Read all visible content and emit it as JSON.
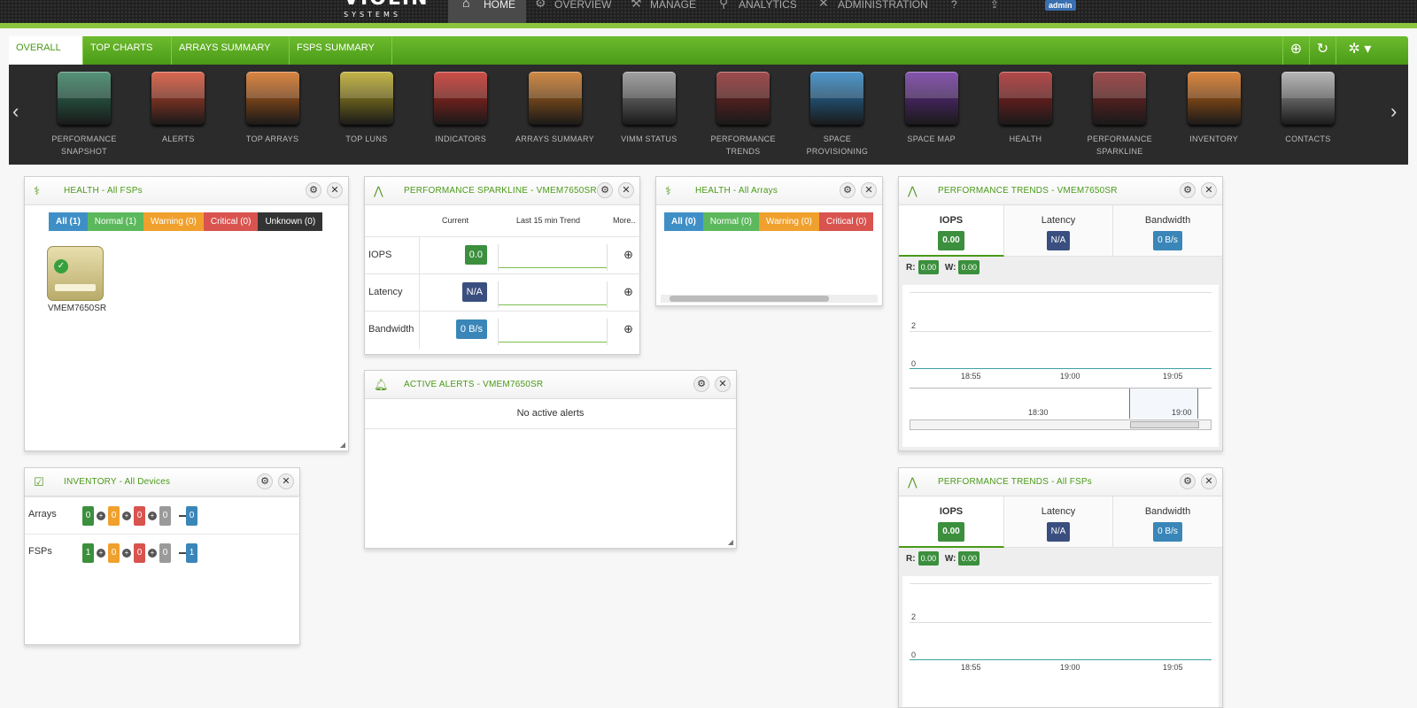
{
  "app": {
    "logo_main": "VIOLIN",
    "logo_sub": "SYSTEMS",
    "user_badge": "admin"
  },
  "nav": [
    {
      "label": "HOME",
      "icon": "home-icon"
    },
    {
      "label": "OVERVIEW",
      "icon": "gear-icon"
    },
    {
      "label": "MANAGE",
      "icon": "wrench-icon"
    },
    {
      "label": "ANALYTICS",
      "icon": "search-icon"
    },
    {
      "label": "ADMINISTRATION",
      "icon": "tools-icon"
    }
  ],
  "tabs": [
    "OVERALL",
    "TOP CHARTS",
    "ARRAYS SUMMARY",
    "FSPS SUMMARY"
  ],
  "carousel": [
    {
      "label": "PERFORMANCE SNAPSHOT",
      "line1": "PERFORMANCE",
      "line2": "SNAPSHOT",
      "icon": "gauge-icon",
      "color": "#2e7b5c"
    },
    {
      "label": "ALERTS",
      "line1": "ALERTS",
      "line2": "",
      "icon": "alarm-icon",
      "color": "#d4472a"
    },
    {
      "label": "TOP ARRAYS",
      "line1": "TOP ARRAYS",
      "line2": "",
      "icon": "arrays-growth-icon",
      "color": "#d36a17"
    },
    {
      "label": "TOP LUNS",
      "line1": "TOP LUNS",
      "line2": "",
      "icon": "database-growth-icon",
      "color": "#b7a51e"
    },
    {
      "label": "INDICATORS",
      "line1": "INDICATORS",
      "line2": "",
      "icon": "thermometer-icon",
      "color": "#c4261f"
    },
    {
      "label": "ARRAYS SUMMARY",
      "line1": "ARRAYS SUMMARY",
      "line2": "",
      "icon": "info-icon",
      "color": "#c46f19"
    },
    {
      "label": "VIMM STATUS",
      "line1": "VIMM STATUS",
      "line2": "",
      "icon": "server-rack-icon",
      "color": "#8d8d8d"
    },
    {
      "label": "PERFORMANCE TRENDS",
      "line1": "PERFORMANCE",
      "line2": "TRENDS",
      "icon": "trend-chart-icon",
      "color": "#8a2424"
    },
    {
      "label": "SPACE PROVISIONING",
      "line1": "SPACE",
      "line2": "PROVISIONING",
      "icon": "disk-stack-icon",
      "color": "#2680c0"
    },
    {
      "label": "SPACE MAP",
      "line1": "SPACE MAP",
      "line2": "",
      "icon": "pie-chart-icon",
      "color": "#6b2e9c"
    },
    {
      "label": "HEALTH",
      "line1": "HEALTH",
      "line2": "",
      "icon": "heartbeat-icon",
      "color": "#a52020"
    },
    {
      "label": "PERFORMANCE SPARKLINE",
      "line1": "PERFORMANCE",
      "line2": "SPARKLINE",
      "icon": "sparkline-icon",
      "color": "#8a2424"
    },
    {
      "label": "INVENTORY",
      "line1": "INVENTORY",
      "line2": "",
      "icon": "bar-chart-icon",
      "color": "#d46b12"
    },
    {
      "label": "CONTACTS",
      "line1": "CONTACTS",
      "line2": "",
      "icon": "phone-icon",
      "color": "#a8a8a8"
    }
  ],
  "health_fsps": {
    "title": "HEALTH - All FSPs",
    "filters": [
      {
        "label": "All (1)",
        "color": "#3f8fc7"
      },
      {
        "label": "Normal (1)",
        "color": "#5cb85c"
      },
      {
        "label": "Warning (0)",
        "color": "#f0a02c"
      },
      {
        "label": "Critical (0)",
        "color": "#d9534f"
      },
      {
        "label": "Unknown (0)",
        "color": "#333333"
      }
    ],
    "device": "VMEM7650SR"
  },
  "sparkline": {
    "title": "PERFORMANCE SPARKLINE - VMEM7650SR",
    "col_current": "Current",
    "col_trend": "Last 15 min Trend",
    "col_more": "More..",
    "rows": [
      {
        "label": "IOPS",
        "value": "0.0",
        "color": "#3b8f3d"
      },
      {
        "label": "Latency",
        "value": "N/A",
        "color": "#3a4f80"
      },
      {
        "label": "Bandwidth",
        "value": "0 B/s",
        "color": "#3a86b8"
      }
    ]
  },
  "health_arrays": {
    "title": "HEALTH - All Arrays",
    "filters": [
      {
        "label": "All (0)",
        "color": "#3f8fc7"
      },
      {
        "label": "Normal (0)",
        "color": "#5cb85c"
      },
      {
        "label": "Warning (0)",
        "color": "#f0a02c"
      },
      {
        "label": "Critical (0)",
        "color": "#d9534f"
      }
    ]
  },
  "alerts": {
    "title": "ACTIVE ALERTS - VMEM7650SR",
    "empty": "No active alerts"
  },
  "inventory": {
    "title": "INVENTORY - All Devices",
    "rows": [
      {
        "label": "Arrays",
        "values": [
          "0",
          "0",
          "0",
          "0"
        ],
        "total": "0"
      },
      {
        "label": "FSPs",
        "values": [
          "1",
          "0",
          "0",
          "0"
        ],
        "total": "1"
      }
    ],
    "colors": [
      "#3b8f3d",
      "#f0a02c",
      "#d9534f",
      "#9a9a9a",
      "#3a86b8"
    ]
  },
  "trends_1": {
    "title": "PERFORMANCE TRENDS - VMEM7650SR",
    "metrics": [
      {
        "label": "IOPS",
        "value": "0.00",
        "color": "#3b8f3d"
      },
      {
        "label": "Latency",
        "value": "N/A",
        "color": "#3a4f80"
      },
      {
        "label": "Bandwidth",
        "value": "0 B/s",
        "color": "#3a86b8"
      }
    ],
    "r_label": "R:",
    "r_value": "0.00",
    "w_label": "W:",
    "w_value": "0.00",
    "y_ticks": [
      "2",
      "0"
    ],
    "x_ticks": [
      "18:55",
      "19:00",
      "19:05"
    ],
    "nav_ticks": [
      "18:30",
      "19:00"
    ]
  },
  "trends_2": {
    "title": "PERFORMANCE TRENDS - All FSPs",
    "metrics": [
      {
        "label": "IOPS",
        "value": "0.00",
        "color": "#3b8f3d"
      },
      {
        "label": "Latency",
        "value": "N/A",
        "color": "#3a4f80"
      },
      {
        "label": "Bandwidth",
        "value": "0 B/s",
        "color": "#3a86b8"
      }
    ],
    "r_label": "R:",
    "r_value": "0.00",
    "w_label": "W:",
    "w_value": "0.00",
    "y_ticks": [
      "2",
      "0"
    ],
    "x_ticks": [
      "18:55",
      "19:00",
      "19:05"
    ]
  }
}
